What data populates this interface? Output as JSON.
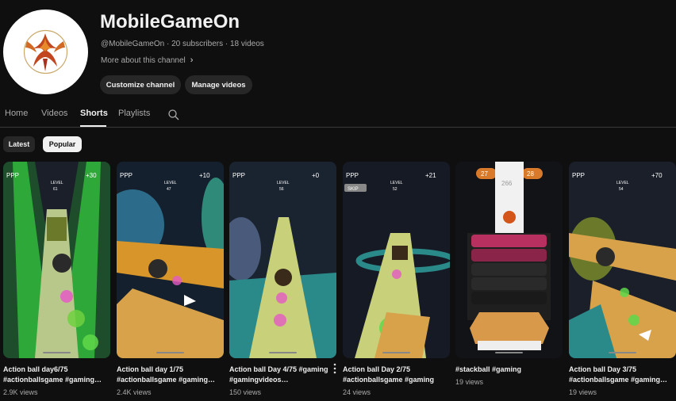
{
  "channel": {
    "name": "MobileGameOn",
    "meta": "@MobileGameOn · 20 subscribers · 18 videos",
    "more_about": "More about this channel",
    "buttons": {
      "customize": "Customize channel",
      "manage": "Manage videos"
    }
  },
  "tabs": [
    {
      "label": "Home"
    },
    {
      "label": "Videos"
    },
    {
      "label": "Shorts",
      "active": true
    },
    {
      "label": "Playlists"
    }
  ],
  "filters": {
    "latest": "Latest",
    "popular": "Popular",
    "selected": "Popular"
  },
  "shorts": [
    {
      "title1": "Action ball day6/75",
      "title2": "#actionballsgame #gaming…",
      "views": "2.9K views",
      "hud_score": "+30",
      "hud_level": "LEVEL",
      "hud_level_num": "61"
    },
    {
      "title1": "Action ball day 1/75",
      "title2": "#actionballsgame #gaming…",
      "views": "2.4K views",
      "hud_score": "+10",
      "hud_level": "LEVEL",
      "hud_level_num": "47"
    },
    {
      "title1": "Action ball Day 4/75 #gaming",
      "title2": "#gamingvideos…",
      "views": "150 views",
      "hud_score": "+0",
      "hud_level": "LEVEL",
      "hud_level_num": "56"
    },
    {
      "title1": "Action ball Day 2/75",
      "title2": "#actionballsgame #gaming",
      "views": "24 views",
      "hud_score": "+21",
      "hud_level": "LEVEL",
      "hud_level_num": "52",
      "hud_skip": "SKIP"
    },
    {
      "title1": "#stackball #gaming",
      "title2": "",
      "views": "19 views",
      "stack_left": "27",
      "stack_right": "28",
      "stack_score": "266"
    },
    {
      "title1": "Action ball Day 3/75",
      "title2": "#actionballsgame #gaming…",
      "views": "19 views",
      "hud_score": "+70",
      "hud_level": "LEVEL",
      "hud_level_num": "54"
    }
  ],
  "colors": {
    "background": "#0f0f0f",
    "chip_selected": "#f1f1f1",
    "button_bg": "#272727",
    "secondary_text": "#aaaaaa"
  }
}
